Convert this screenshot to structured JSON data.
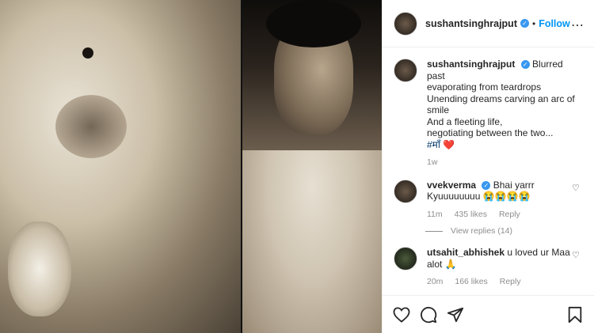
{
  "post": {
    "username": "sushantsinghrajput",
    "follow_label": "Follow",
    "caption_lines": [
      "Blurred past",
      "evaporating from teardrops",
      "Unending dreams carving an arc of",
      "smile",
      "And a fleeting life,",
      "negotiating between the two...",
      "#माँ ❤️"
    ],
    "caption_time": "1w"
  },
  "comments": [
    {
      "username": "vvekverma",
      "text_line1": "Bhai yarrr",
      "text_line2": "Kyuuuuuuuu 😭😭😭😭",
      "time": "11m",
      "likes": "435 likes",
      "reply": "Reply",
      "view_replies": "View replies (14)"
    },
    {
      "username": "utsahit_abhishek",
      "text_line1": "u loved ur Maa",
      "text_line2": "alot 🙏",
      "time": "20m",
      "likes": "166 likes",
      "reply": "Reply"
    }
  ],
  "icons": {
    "verified": "verified-badge",
    "more": "more-options-icon",
    "like": "heart-icon",
    "comment": "comment-icon",
    "share": "share-icon",
    "save": "bookmark-icon"
  },
  "colors": {
    "accent": "#0095f6",
    "verified": "#3897f0",
    "text": "#262626",
    "muted": "#8e8e8e"
  }
}
